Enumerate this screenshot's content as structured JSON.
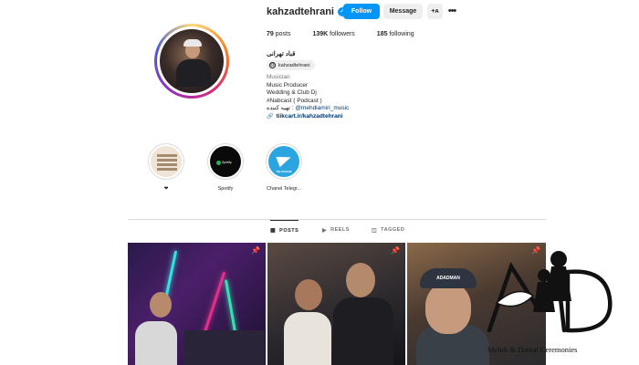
{
  "profile": {
    "username": "kahzadtehrani",
    "display_name": "قباد تهرانی",
    "threads_handle": "kahzadtehrani",
    "verified_icon": "verified-badge-icon"
  },
  "actions": {
    "follow_label": "Follow",
    "message_label": "Message",
    "add_user_label": "+ᴀ",
    "more_label": "•••"
  },
  "stats": {
    "posts_count": "79",
    "posts_label": "posts",
    "followers_count": "139K",
    "followers_label": "followers",
    "following_count": "185",
    "following_label": "following"
  },
  "bio": {
    "category": "Musician",
    "line1": "Music Producer",
    "line2": "Wedding & Club Dj",
    "line3": "#Nabcast ( Podcast )",
    "line4_prefix": "تهیه کننده : ",
    "line4_mention": "@mehdiamiri_music",
    "link": "tiikcart.ir/kahzadtehrani"
  },
  "highlights": [
    {
      "label": "❤",
      "icon": "calligraphy-cover"
    },
    {
      "label": "Spotify",
      "icon": "spotify-logo",
      "cover_text": "Spotify"
    },
    {
      "label": "Chanel Telegr...",
      "icon": "telegram-logo",
      "cover_text": "TELEGRAM"
    }
  ],
  "tabs": [
    {
      "label": "POSTS",
      "icon": "grid-icon",
      "active": true
    },
    {
      "label": "REELS",
      "icon": "reels-icon",
      "active": false
    },
    {
      "label": "TAGGED",
      "icon": "tagged-icon",
      "active": false
    }
  ],
  "posts": [
    {
      "pinned": true,
      "icon": "pin-icon"
    },
    {
      "pinned": true,
      "icon": "pin-icon"
    },
    {
      "pinned": true,
      "icon": "pin-icon",
      "cap_text": "ADADMAN"
    }
  ],
  "watermark": {
    "caption": "Mehdi & Danial Ceremonies"
  },
  "colors": {
    "primary_button": "#0095f6",
    "secondary_button": "#efefef",
    "link": "#00376b",
    "spotify": "#1db954",
    "telegram": "#2aa5e0"
  }
}
